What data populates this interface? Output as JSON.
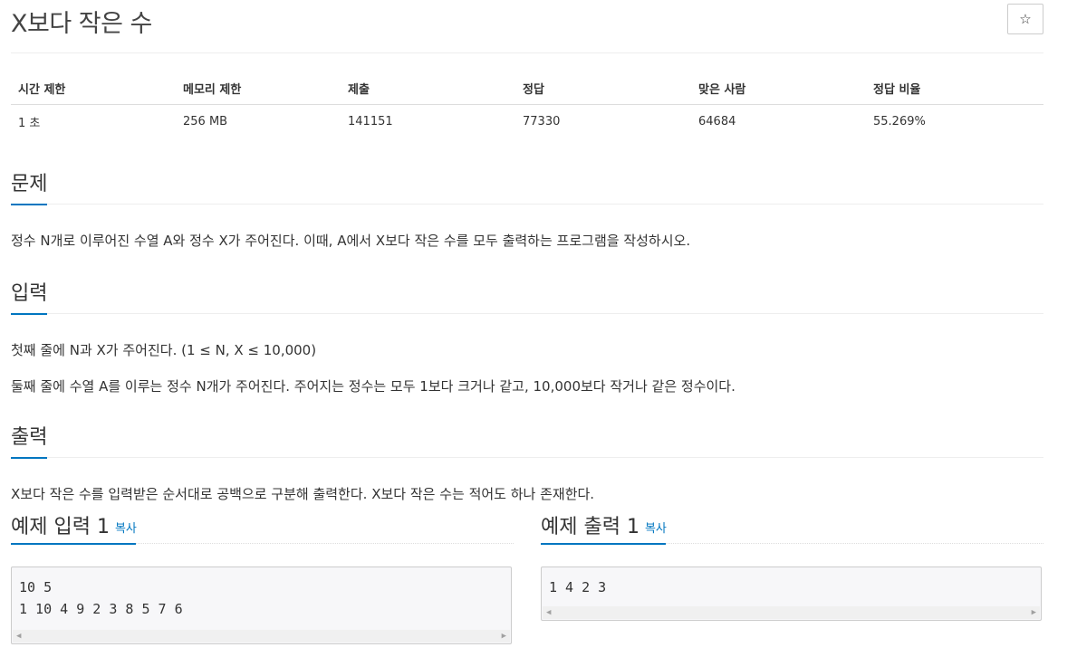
{
  "problem": {
    "title": "X보다 작은 수",
    "star": "☆"
  },
  "info": {
    "headers": [
      "시간 제한",
      "메모리 제한",
      "제출",
      "정답",
      "맞은 사람",
      "정답 비율"
    ],
    "values": [
      "1 초",
      "256 MB",
      "141151",
      "77330",
      "64684",
      "55.269%"
    ]
  },
  "sections": {
    "description": {
      "title": "문제",
      "text": "정수 N개로 이루어진 수열 A와 정수 X가 주어진다. 이때, A에서 X보다 작은 수를 모두 출력하는 프로그램을 작성하시오."
    },
    "input": {
      "title": "입력",
      "line1": "첫째 줄에 N과 X가 주어진다. (1 ≤ N, X ≤ 10,000)",
      "line2": "둘째 줄에 수열 A를 이루는 정수 N개가 주어진다. 주어지는 정수는 모두 1보다 크거나 같고, 10,000보다 작거나 같은 정수이다."
    },
    "output": {
      "title": "출력",
      "text": "X보다 작은 수를 입력받은 순서대로 공백으로 구분해 출력한다. X보다 작은 수는 적어도 하나 존재한다."
    }
  },
  "samples": {
    "input": {
      "title": "예제 입력 1",
      "copy": "복사",
      "data": "10 5\n1 10 4 9 2 3 8 5 7 6"
    },
    "output": {
      "title": "예제 출력 1",
      "copy": "복사",
      "data": "1 4 2 3"
    }
  }
}
